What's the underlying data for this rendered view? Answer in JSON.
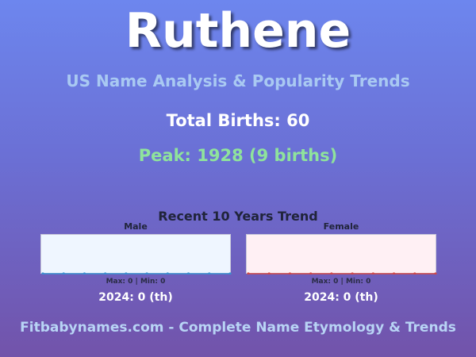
{
  "header": {
    "name": "Ruthene",
    "subtitle": "US Name Analysis & Popularity Trends",
    "total_births": "Total Births: 60",
    "peak": "Peak: 1928 (9 births)"
  },
  "trend": {
    "title": "Recent 10 Years Trend",
    "male": {
      "label": "Male",
      "maxmin": "Max: 0 | Min: 0",
      "rank": "2024: 0 (th)",
      "color": "#3a8fd0",
      "background": "#eff6ff"
    },
    "female": {
      "label": "Female",
      "maxmin": "Max: 0 | Min: 0",
      "rank": "2024: 0 (th)",
      "color": "#d04848",
      "background": "#fff0f4"
    }
  },
  "chart_data": [
    {
      "type": "line",
      "series": [
        {
          "name": "Male",
          "values": [
            0,
            0,
            0,
            0,
            0,
            0,
            0,
            0,
            0,
            0
          ]
        }
      ],
      "ylim": [
        0,
        0
      ]
    },
    {
      "type": "line",
      "series": [
        {
          "name": "Female",
          "values": [
            0,
            0,
            0,
            0,
            0,
            0,
            0,
            0,
            0,
            0
          ]
        }
      ],
      "ylim": [
        0,
        0
      ]
    }
  ],
  "footer": {
    "text": "Fitbabynames.com - Complete Name Etymology & Trends"
  }
}
